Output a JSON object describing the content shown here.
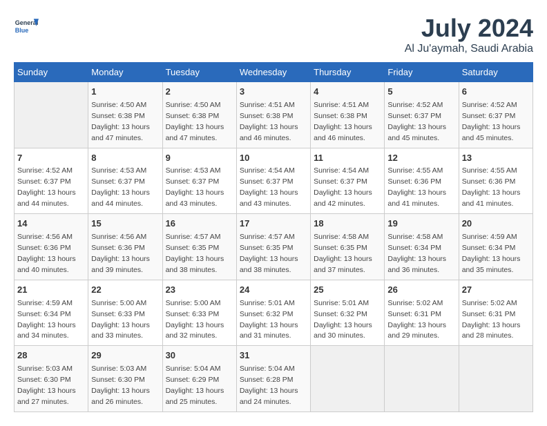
{
  "header": {
    "logo_general": "General",
    "logo_blue": "Blue",
    "month": "July 2024",
    "location": "Al Ju'aymah, Saudi Arabia"
  },
  "weekdays": [
    "Sunday",
    "Monday",
    "Tuesday",
    "Wednesday",
    "Thursday",
    "Friday",
    "Saturday"
  ],
  "weeks": [
    [
      {
        "day": "",
        "sunrise": "",
        "sunset": "",
        "daylight": "",
        "minutes": ""
      },
      {
        "day": "1",
        "sunrise": "Sunrise: 4:50 AM",
        "sunset": "Sunset: 6:38 PM",
        "daylight": "Daylight: 13 hours",
        "minutes": "and 47 minutes."
      },
      {
        "day": "2",
        "sunrise": "Sunrise: 4:50 AM",
        "sunset": "Sunset: 6:38 PM",
        "daylight": "Daylight: 13 hours",
        "minutes": "and 47 minutes."
      },
      {
        "day": "3",
        "sunrise": "Sunrise: 4:51 AM",
        "sunset": "Sunset: 6:38 PM",
        "daylight": "Daylight: 13 hours",
        "minutes": "and 46 minutes."
      },
      {
        "day": "4",
        "sunrise": "Sunrise: 4:51 AM",
        "sunset": "Sunset: 6:38 PM",
        "daylight": "Daylight: 13 hours",
        "minutes": "and 46 minutes."
      },
      {
        "day": "5",
        "sunrise": "Sunrise: 4:52 AM",
        "sunset": "Sunset: 6:37 PM",
        "daylight": "Daylight: 13 hours",
        "minutes": "and 45 minutes."
      },
      {
        "day": "6",
        "sunrise": "Sunrise: 4:52 AM",
        "sunset": "Sunset: 6:37 PM",
        "daylight": "Daylight: 13 hours",
        "minutes": "and 45 minutes."
      }
    ],
    [
      {
        "day": "7",
        "sunrise": "Sunrise: 4:52 AM",
        "sunset": "Sunset: 6:37 PM",
        "daylight": "Daylight: 13 hours",
        "minutes": "and 44 minutes."
      },
      {
        "day": "8",
        "sunrise": "Sunrise: 4:53 AM",
        "sunset": "Sunset: 6:37 PM",
        "daylight": "Daylight: 13 hours",
        "minutes": "and 44 minutes."
      },
      {
        "day": "9",
        "sunrise": "Sunrise: 4:53 AM",
        "sunset": "Sunset: 6:37 PM",
        "daylight": "Daylight: 13 hours",
        "minutes": "and 43 minutes."
      },
      {
        "day": "10",
        "sunrise": "Sunrise: 4:54 AM",
        "sunset": "Sunset: 6:37 PM",
        "daylight": "Daylight: 13 hours",
        "minutes": "and 43 minutes."
      },
      {
        "day": "11",
        "sunrise": "Sunrise: 4:54 AM",
        "sunset": "Sunset: 6:37 PM",
        "daylight": "Daylight: 13 hours",
        "minutes": "and 42 minutes."
      },
      {
        "day": "12",
        "sunrise": "Sunrise: 4:55 AM",
        "sunset": "Sunset: 6:36 PM",
        "daylight": "Daylight: 13 hours",
        "minutes": "and 41 minutes."
      },
      {
        "day": "13",
        "sunrise": "Sunrise: 4:55 AM",
        "sunset": "Sunset: 6:36 PM",
        "daylight": "Daylight: 13 hours",
        "minutes": "and 41 minutes."
      }
    ],
    [
      {
        "day": "14",
        "sunrise": "Sunrise: 4:56 AM",
        "sunset": "Sunset: 6:36 PM",
        "daylight": "Daylight: 13 hours",
        "minutes": "and 40 minutes."
      },
      {
        "day": "15",
        "sunrise": "Sunrise: 4:56 AM",
        "sunset": "Sunset: 6:36 PM",
        "daylight": "Daylight: 13 hours",
        "minutes": "and 39 minutes."
      },
      {
        "day": "16",
        "sunrise": "Sunrise: 4:57 AM",
        "sunset": "Sunset: 6:35 PM",
        "daylight": "Daylight: 13 hours",
        "minutes": "and 38 minutes."
      },
      {
        "day": "17",
        "sunrise": "Sunrise: 4:57 AM",
        "sunset": "Sunset: 6:35 PM",
        "daylight": "Daylight: 13 hours",
        "minutes": "and 38 minutes."
      },
      {
        "day": "18",
        "sunrise": "Sunrise: 4:58 AM",
        "sunset": "Sunset: 6:35 PM",
        "daylight": "Daylight: 13 hours",
        "minutes": "and 37 minutes."
      },
      {
        "day": "19",
        "sunrise": "Sunrise: 4:58 AM",
        "sunset": "Sunset: 6:34 PM",
        "daylight": "Daylight: 13 hours",
        "minutes": "and 36 minutes."
      },
      {
        "day": "20",
        "sunrise": "Sunrise: 4:59 AM",
        "sunset": "Sunset: 6:34 PM",
        "daylight": "Daylight: 13 hours",
        "minutes": "and 35 minutes."
      }
    ],
    [
      {
        "day": "21",
        "sunrise": "Sunrise: 4:59 AM",
        "sunset": "Sunset: 6:34 PM",
        "daylight": "Daylight: 13 hours",
        "minutes": "and 34 minutes."
      },
      {
        "day": "22",
        "sunrise": "Sunrise: 5:00 AM",
        "sunset": "Sunset: 6:33 PM",
        "daylight": "Daylight: 13 hours",
        "minutes": "and 33 minutes."
      },
      {
        "day": "23",
        "sunrise": "Sunrise: 5:00 AM",
        "sunset": "Sunset: 6:33 PM",
        "daylight": "Daylight: 13 hours",
        "minutes": "and 32 minutes."
      },
      {
        "day": "24",
        "sunrise": "Sunrise: 5:01 AM",
        "sunset": "Sunset: 6:32 PM",
        "daylight": "Daylight: 13 hours",
        "minutes": "and 31 minutes."
      },
      {
        "day": "25",
        "sunrise": "Sunrise: 5:01 AM",
        "sunset": "Sunset: 6:32 PM",
        "daylight": "Daylight: 13 hours",
        "minutes": "and 30 minutes."
      },
      {
        "day": "26",
        "sunrise": "Sunrise: 5:02 AM",
        "sunset": "Sunset: 6:31 PM",
        "daylight": "Daylight: 13 hours",
        "minutes": "and 29 minutes."
      },
      {
        "day": "27",
        "sunrise": "Sunrise: 5:02 AM",
        "sunset": "Sunset: 6:31 PM",
        "daylight": "Daylight: 13 hours",
        "minutes": "and 28 minutes."
      }
    ],
    [
      {
        "day": "28",
        "sunrise": "Sunrise: 5:03 AM",
        "sunset": "Sunset: 6:30 PM",
        "daylight": "Daylight: 13 hours",
        "minutes": "and 27 minutes."
      },
      {
        "day": "29",
        "sunrise": "Sunrise: 5:03 AM",
        "sunset": "Sunset: 6:30 PM",
        "daylight": "Daylight: 13 hours",
        "minutes": "and 26 minutes."
      },
      {
        "day": "30",
        "sunrise": "Sunrise: 5:04 AM",
        "sunset": "Sunset: 6:29 PM",
        "daylight": "Daylight: 13 hours",
        "minutes": "and 25 minutes."
      },
      {
        "day": "31",
        "sunrise": "Sunrise: 5:04 AM",
        "sunset": "Sunset: 6:28 PM",
        "daylight": "Daylight: 13 hours",
        "minutes": "and 24 minutes."
      },
      {
        "day": "",
        "sunrise": "",
        "sunset": "",
        "daylight": "",
        "minutes": ""
      },
      {
        "day": "",
        "sunrise": "",
        "sunset": "",
        "daylight": "",
        "minutes": ""
      },
      {
        "day": "",
        "sunrise": "",
        "sunset": "",
        "daylight": "",
        "minutes": ""
      }
    ]
  ]
}
